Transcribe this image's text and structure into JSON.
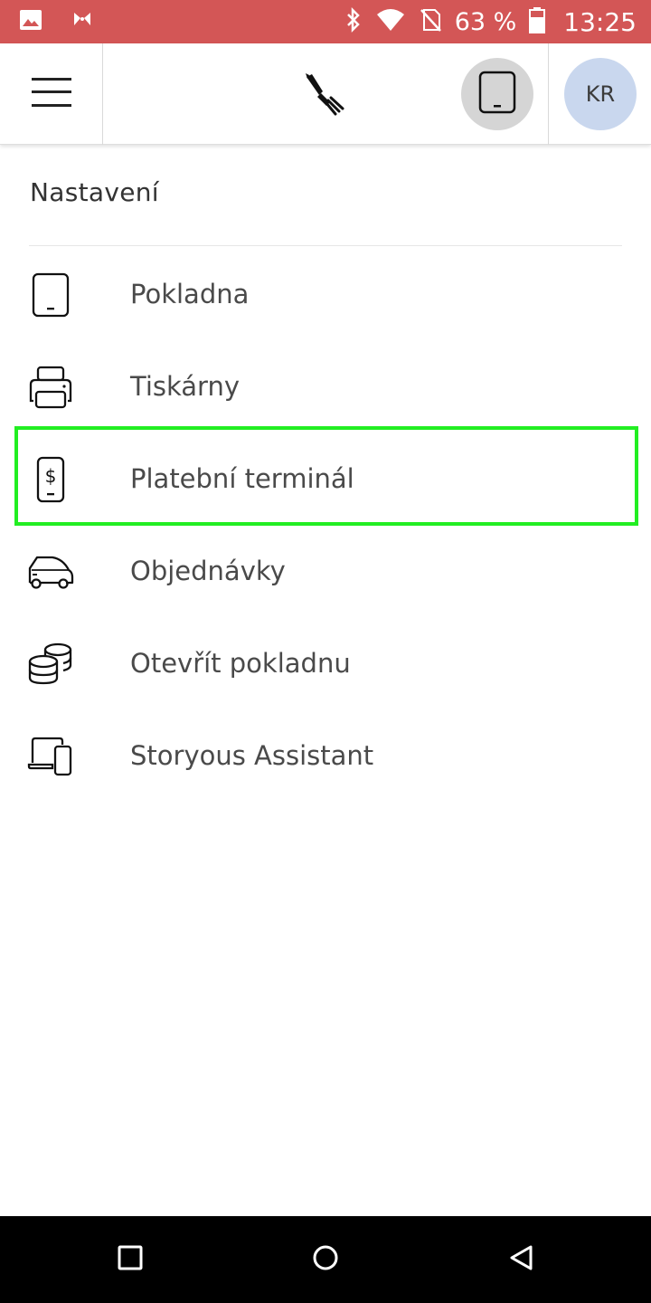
{
  "status_bar": {
    "battery_percent": "63 %",
    "time": "13:25",
    "icons": [
      "gallery-icon",
      "app-notification-icon",
      "bluetooth-icon",
      "wifi-icon",
      "no-sim-icon",
      "battery-icon"
    ]
  },
  "app_bar": {
    "menu_icon": "hamburger-menu-icon",
    "logo_icon": "storyous-logo-icon",
    "device_icon": "tablet-icon",
    "avatar_initials": "KR"
  },
  "page": {
    "title": "Nastavení"
  },
  "menu": {
    "items": [
      {
        "label": "Pokladna",
        "icon": "tablet-icon"
      },
      {
        "label": "Tiskárny",
        "icon": "printer-icon"
      },
      {
        "label": "Platební terminál",
        "icon": "payment-terminal-icon",
        "highlighted": true
      },
      {
        "label": "Objednávky",
        "icon": "delivery-car-icon"
      },
      {
        "label": "Otevřít pokladnu",
        "icon": "coins-icon"
      },
      {
        "label": "Storyous Assistant",
        "icon": "laptop-phone-icon"
      }
    ]
  },
  "colors": {
    "status_bar": "#d35656",
    "highlight": "#22ee22",
    "avatar_bg": "#c9d7ee",
    "device_btn_bg": "#d5d5d5"
  },
  "nav_bar": {
    "buttons": [
      "recents-square-icon",
      "home-circle-icon",
      "back-triangle-icon"
    ]
  }
}
